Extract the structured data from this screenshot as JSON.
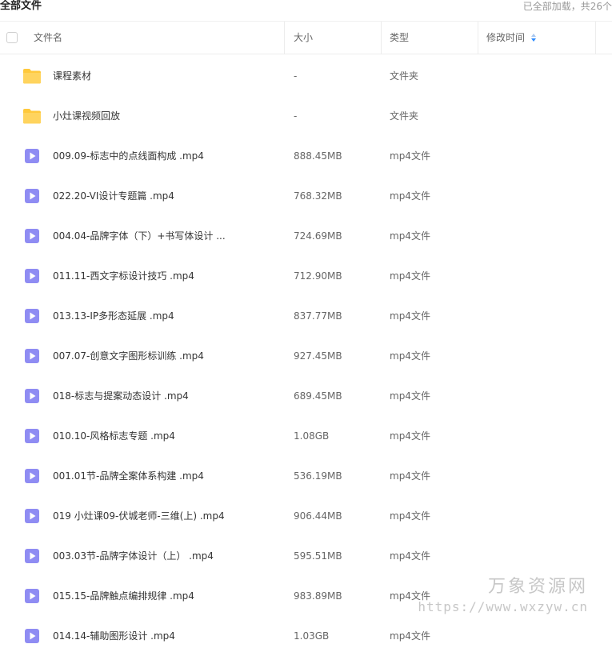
{
  "header": {
    "title": "全部文件",
    "loaded_status": "已全部加载，共26个"
  },
  "columns": {
    "name": "文件名",
    "size": "大小",
    "type": "类型",
    "modified": "修改时间"
  },
  "files": [
    {
      "icon": "folder-icon",
      "name": "课程素材",
      "size": "-",
      "type": "文件夹"
    },
    {
      "icon": "folder-icon",
      "name": "小灶课视频回放",
      "size": "-",
      "type": "文件夹"
    },
    {
      "icon": "video-file-icon",
      "name": "009.09-标志中的点线面构成 .mp4",
      "size": "888.45MB",
      "type": "mp4文件"
    },
    {
      "icon": "video-file-icon",
      "name": "022.20-VI设计专题篇 .mp4",
      "size": "768.32MB",
      "type": "mp4文件"
    },
    {
      "icon": "video-file-icon",
      "name": "004.04-品牌字体（下）+书写体设计 ...",
      "size": "724.69MB",
      "type": "mp4文件"
    },
    {
      "icon": "video-file-icon",
      "name": "011.11-西文字标设计技巧 .mp4",
      "size": "712.90MB",
      "type": "mp4文件"
    },
    {
      "icon": "video-file-icon",
      "name": "013.13-IP多形态延展 .mp4",
      "size": "837.77MB",
      "type": "mp4文件"
    },
    {
      "icon": "video-file-icon",
      "name": "007.07-创意文字图形标训练 .mp4",
      "size": "927.45MB",
      "type": "mp4文件"
    },
    {
      "icon": "video-file-icon",
      "name": "018-标志与提案动态设计 .mp4",
      "size": "689.45MB",
      "type": "mp4文件"
    },
    {
      "icon": "video-file-icon",
      "name": "010.10-风格标志专题 .mp4",
      "size": "1.08GB",
      "type": "mp4文件"
    },
    {
      "icon": "video-file-icon",
      "name": "001.01节-品牌全案体系构建 .mp4",
      "size": "536.19MB",
      "type": "mp4文件"
    },
    {
      "icon": "video-file-icon",
      "name": "019 小灶课09-伏城老师-三维(上) .mp4",
      "size": "906.44MB",
      "type": "mp4文件"
    },
    {
      "icon": "video-file-icon",
      "name": "003.03节-品牌字体设计（上） .mp4",
      "size": "595.51MB",
      "type": "mp4文件"
    },
    {
      "icon": "video-file-icon",
      "name": "015.15-品牌触点编排规律 .mp4",
      "size": "983.89MB",
      "type": "mp4文件"
    },
    {
      "icon": "video-file-icon",
      "name": "014.14-辅助图形设计 .mp4",
      "size": "1.03GB",
      "type": "mp4文件"
    }
  ],
  "watermark": {
    "title": "万象资源网",
    "url": "https://www.wxzyw.cn"
  },
  "colors": {
    "folder": "#FFC93C",
    "video": "#8F8CF3",
    "sort_active": "#2E8CFF"
  }
}
